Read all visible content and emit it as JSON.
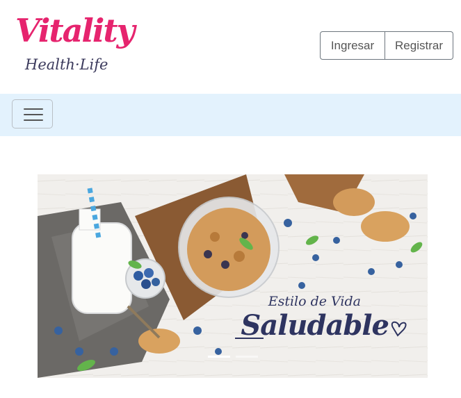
{
  "header": {
    "logo": {
      "brand": "Vitality",
      "tagline": "Health·Life"
    },
    "auth": {
      "login_label": "Ingresar",
      "register_label": "Registrar"
    }
  },
  "navbar": {
    "toggler_icon": "hamburger-icon",
    "background": "#e3f2fd"
  },
  "carousel": {
    "slide_text_small": "Estilo de Vida",
    "slide_text_big": "Saludable",
    "indicator_count": 2,
    "active_indicator": 1
  },
  "colors": {
    "brand_pink": "#e6246e",
    "brand_navy": "#2e3460"
  }
}
